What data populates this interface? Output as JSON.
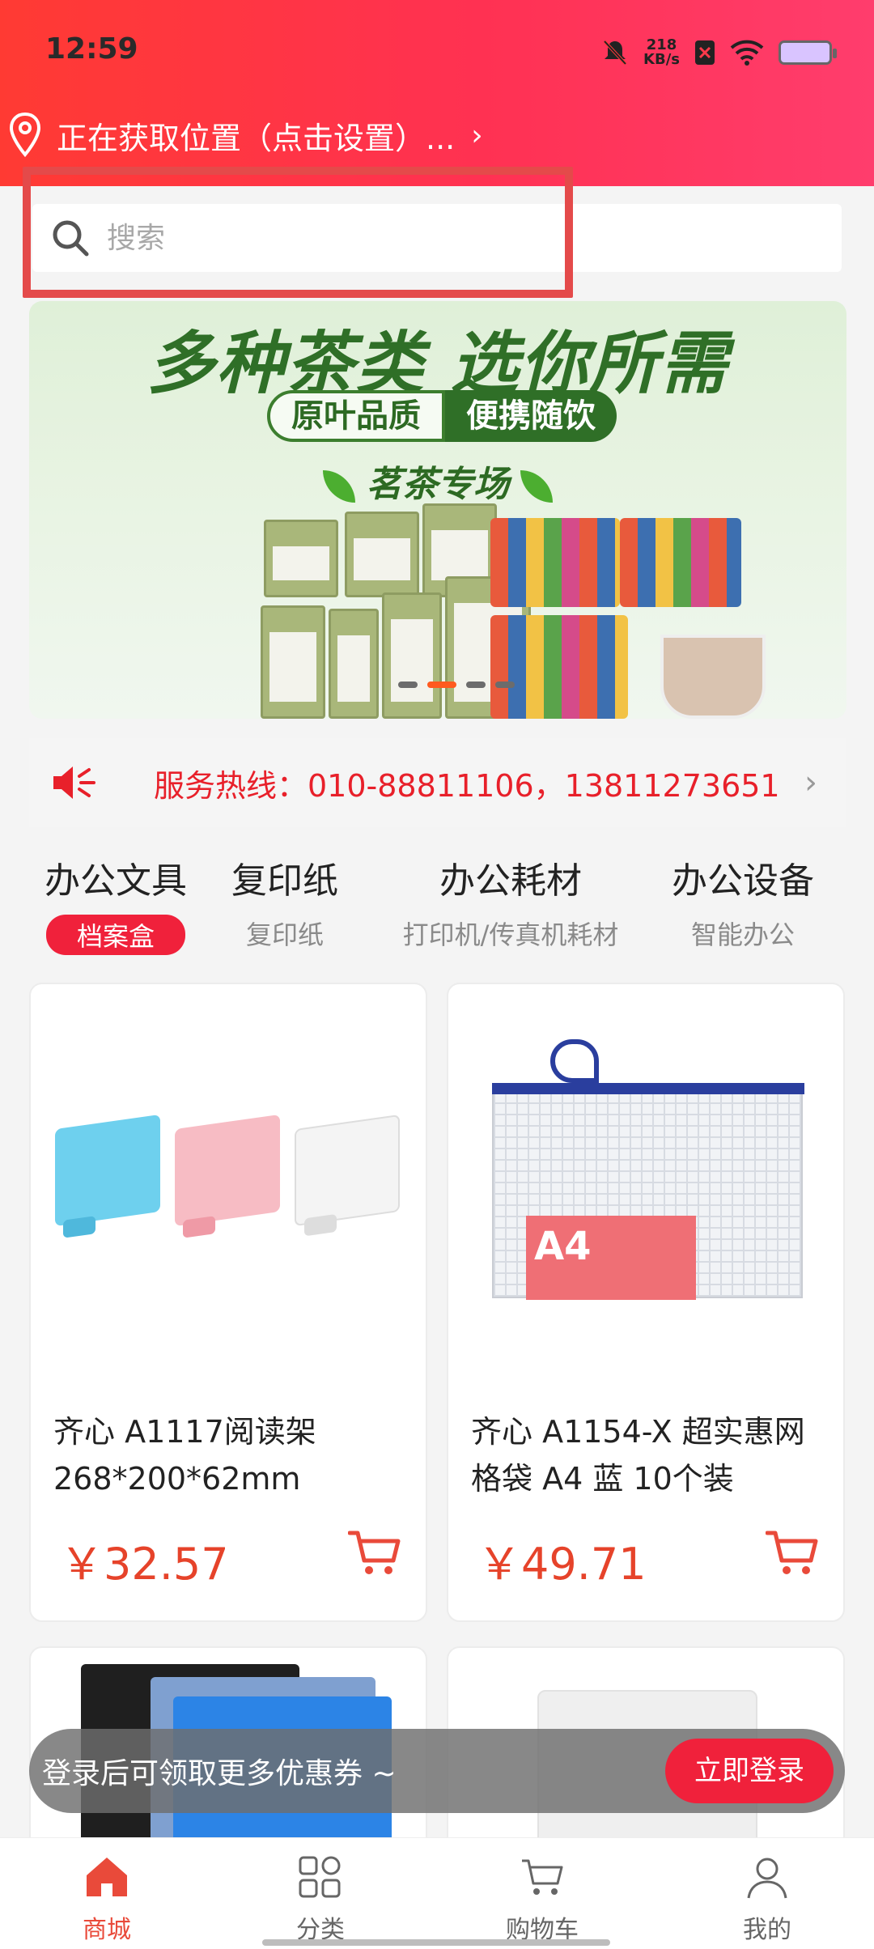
{
  "status_bar": {
    "time": "12:59",
    "net_speed_value": "218",
    "net_speed_unit": "KB/s"
  },
  "location": {
    "text": "正在获取位置（点击设置）...",
    "chevron": "›"
  },
  "search": {
    "placeholder": "搜索"
  },
  "banner": {
    "title": "多种茶类 选你所需",
    "pill_left": "原叶品质",
    "pill_right": "便携随饮",
    "subtitle": "茗茶专场",
    "slide_count": 4,
    "active_slide": 1
  },
  "hotline": {
    "text": "服务热线：010-88811106，13811273651",
    "arrow": "›"
  },
  "categories": [
    {
      "title": "办公文具",
      "sub": "档案盒",
      "active": true
    },
    {
      "title": "复印纸",
      "sub": "复印纸",
      "active": false
    },
    {
      "title": "办公耗材",
      "sub": "打印机/传真机耗材",
      "active": false
    },
    {
      "title": "办公设备",
      "sub": "智能办公",
      "active": false
    }
  ],
  "products": [
    {
      "name_line1": "齐心 A1117阅读架",
      "name_line2": "268*200*62mm",
      "price": "￥32.57"
    },
    {
      "name_line1": "齐心 A1154-X 超实惠网",
      "name_line2": "格袋 A4 蓝 10个装",
      "price": "￥49.71"
    }
  ],
  "product_images": {
    "bag_label": "A4"
  },
  "login_bar": {
    "message": "登录后可领取更多优惠券 ~",
    "button": "立即登录"
  },
  "bottom_nav": [
    {
      "label": "商城",
      "icon": "home-icon",
      "active": true
    },
    {
      "label": "分类",
      "icon": "category-grid-icon",
      "active": false
    },
    {
      "label": "购物车",
      "icon": "cart-icon",
      "active": false
    },
    {
      "label": "我的",
      "icon": "profile-icon",
      "active": false
    }
  ],
  "colors": {
    "brand_red": "#f0213b",
    "price_orange": "#e6432a",
    "highlight_box": "#e44a4a"
  }
}
